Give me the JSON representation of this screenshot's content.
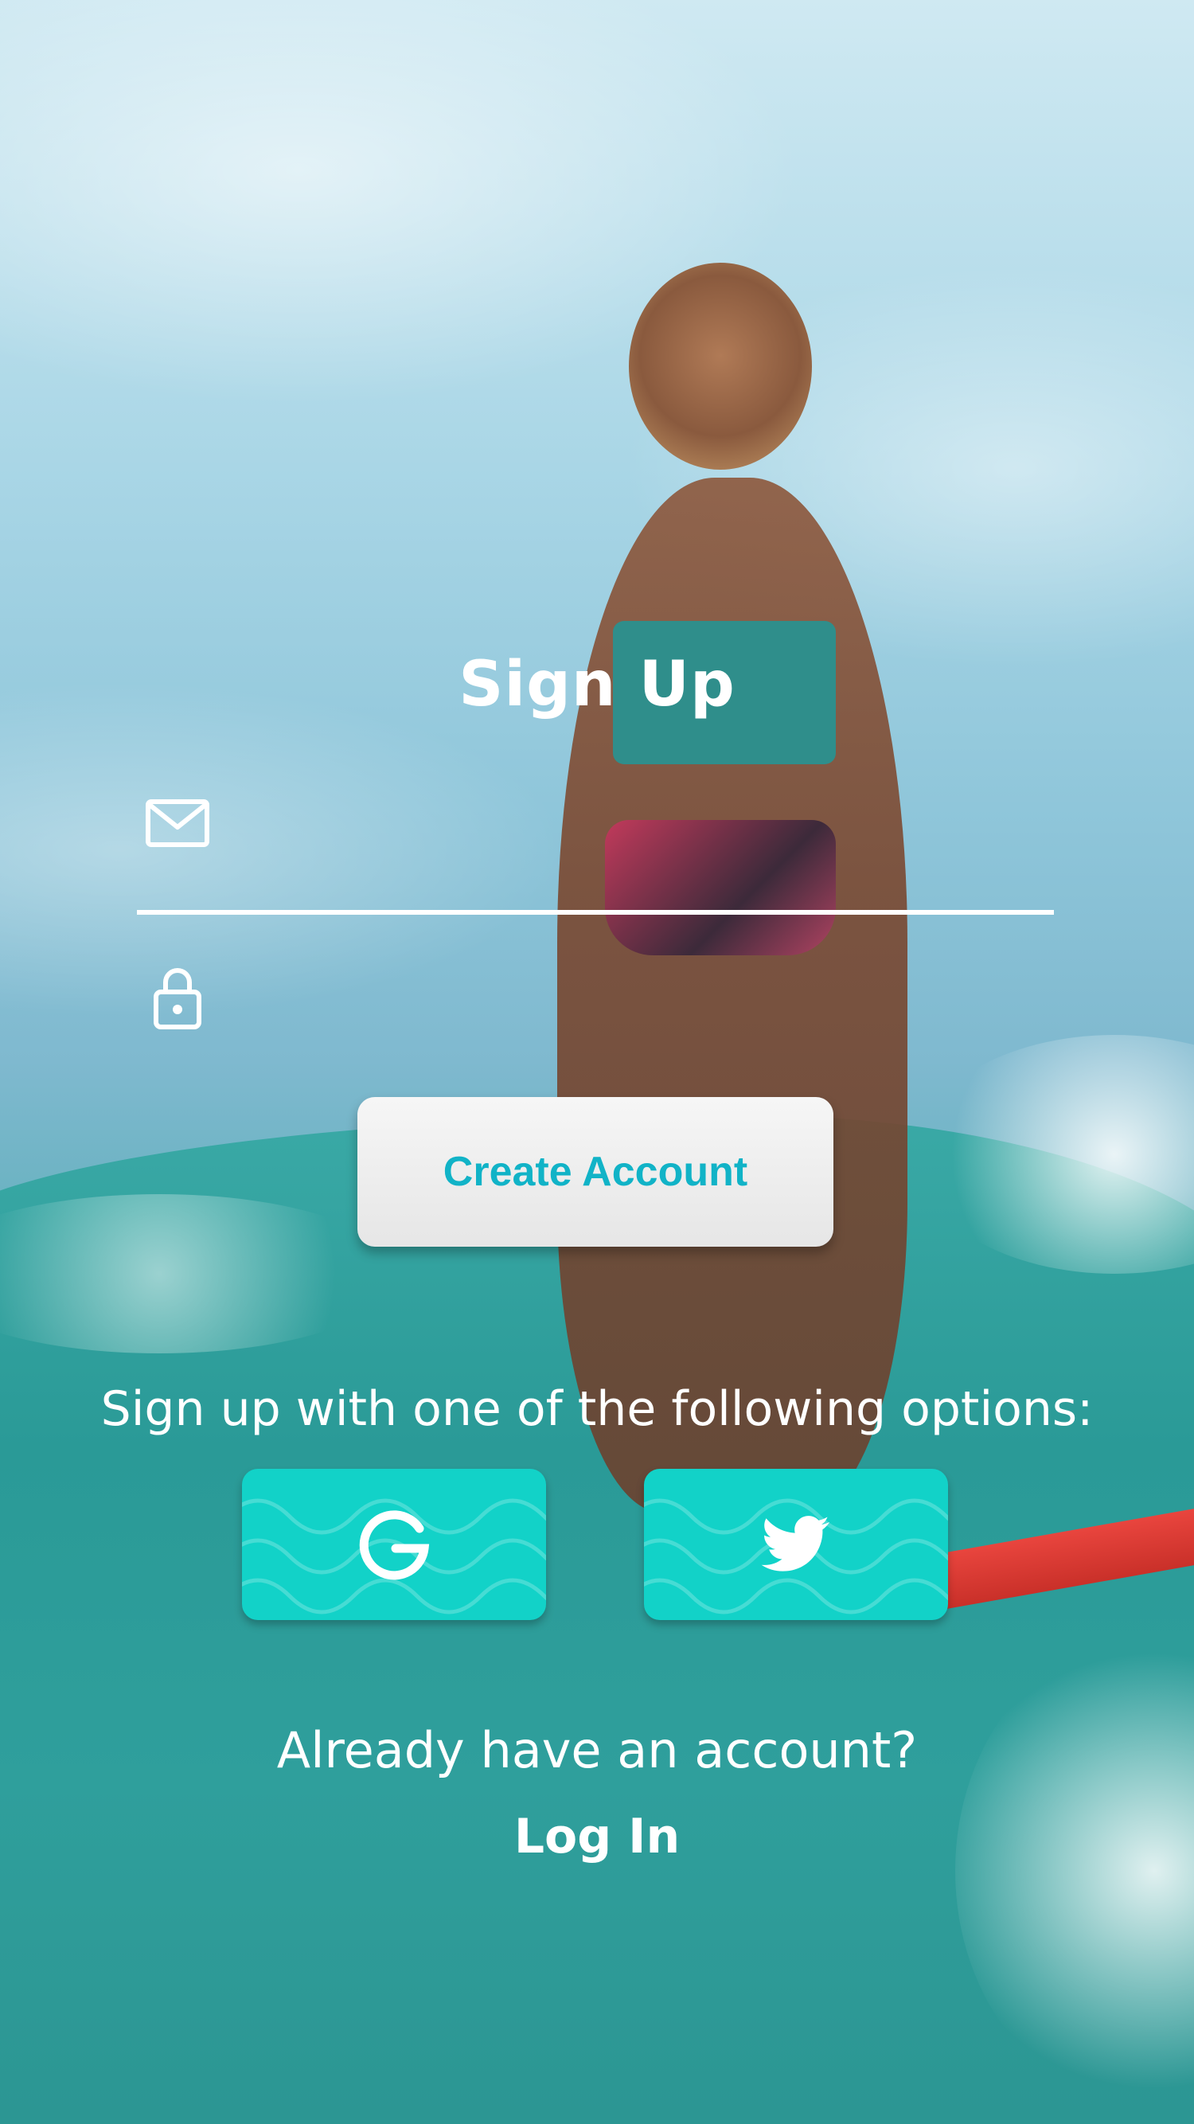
{
  "screen": {
    "title": "Sign Up"
  },
  "form": {
    "email_icon": "mail-icon",
    "email_value": "",
    "password_icon": "lock-icon",
    "password_value": "",
    "create_button_label": "Create Account"
  },
  "social": {
    "prompt": "Sign up with one of the following options:",
    "google_icon": "google-icon",
    "twitter_icon": "twitter-icon"
  },
  "footer": {
    "question": "Already have an account?",
    "login_label": "Log In"
  },
  "colors": {
    "accent": "#11b3c7",
    "social_button": "#12d2c8",
    "text": "#ffffff"
  }
}
